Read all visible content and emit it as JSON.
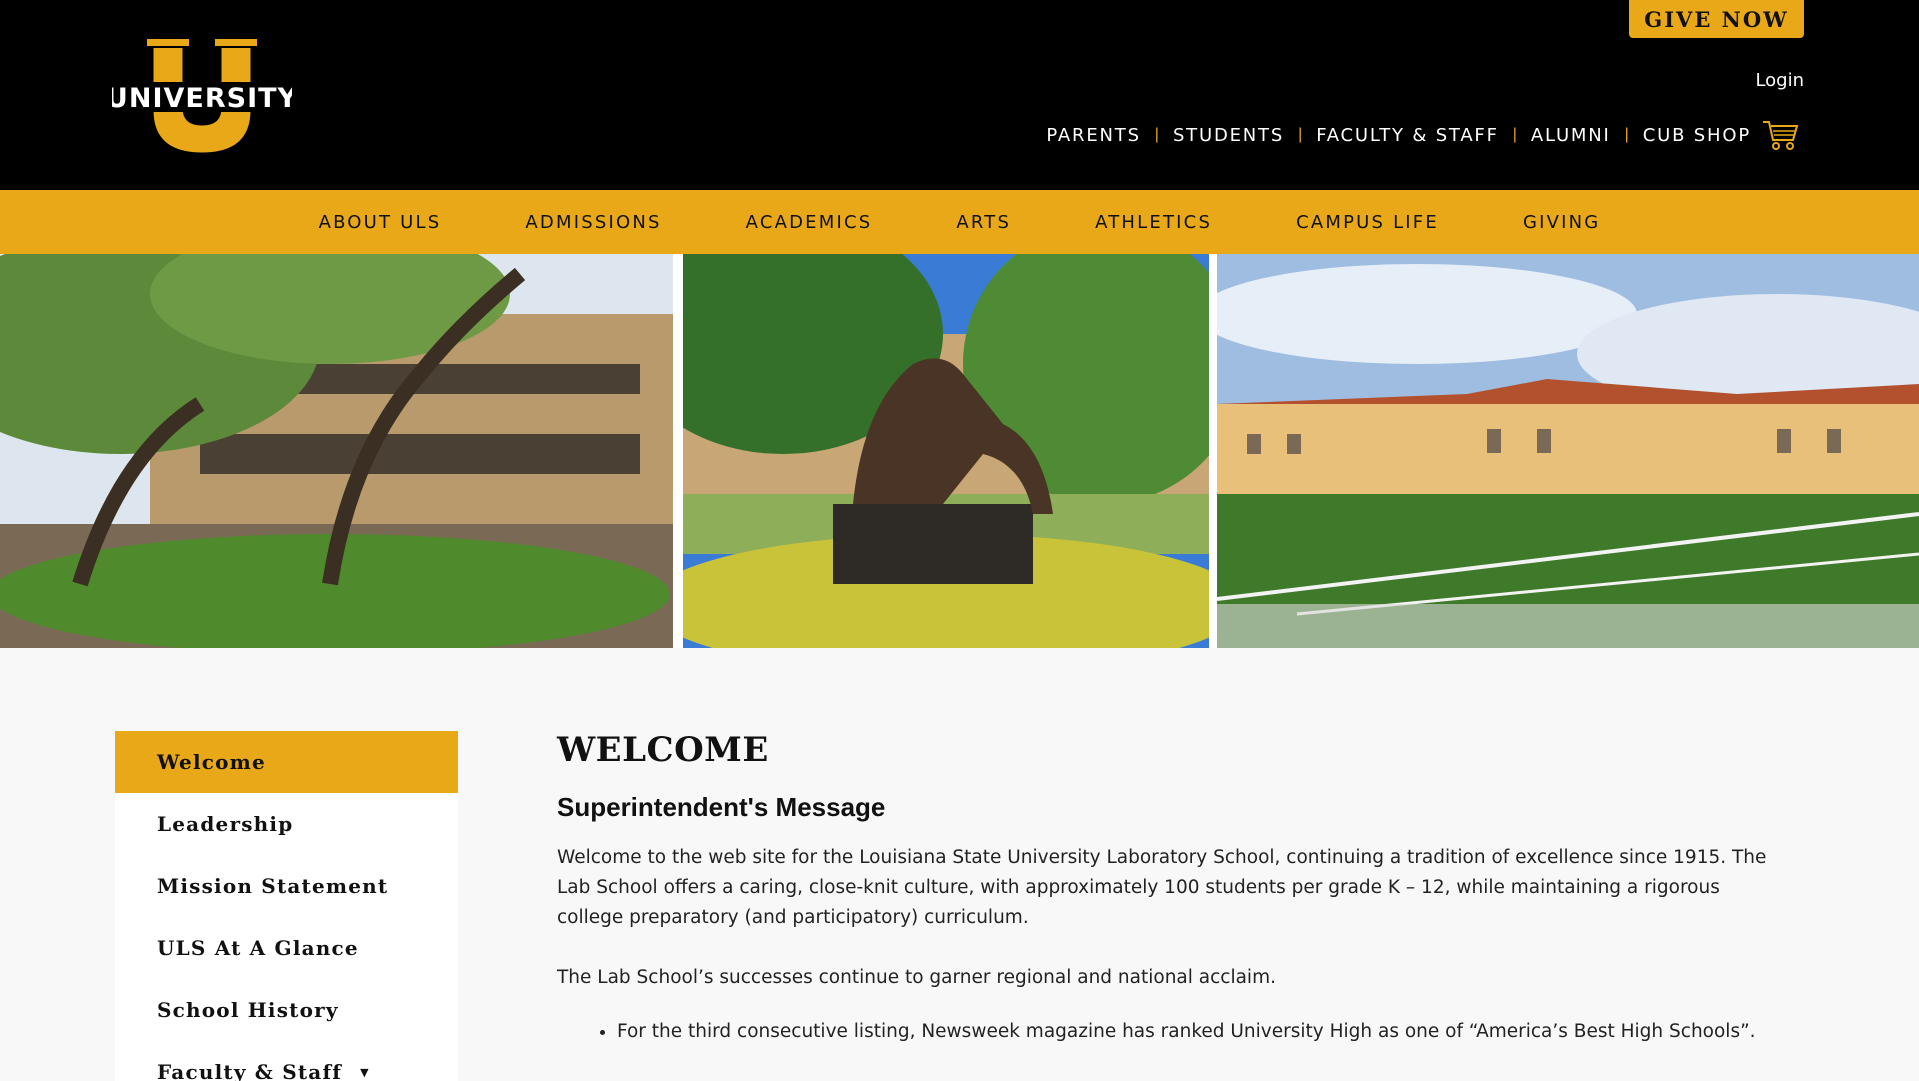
{
  "header": {
    "logo_text": "UNIVERSITY",
    "give_label": "GIVE NOW",
    "login_label": "Login",
    "top_nav": [
      "PARENTS",
      "STUDENTS",
      "FACULTY & STAFF",
      "ALUMNI",
      "CUB SHOP"
    ],
    "cart_icon": "cart-icon"
  },
  "main_nav": [
    "ABOUT ULS",
    "ADMISSIONS",
    "ACADEMICS",
    "ARTS",
    "ATHLETICS",
    "CAMPUS LIFE",
    "GIVING"
  ],
  "sidebar": {
    "items": [
      {
        "label": "Welcome",
        "active": true
      },
      {
        "label": "Leadership"
      },
      {
        "label": "Mission Statement"
      },
      {
        "label": "ULS At A Glance"
      },
      {
        "label": "School History"
      },
      {
        "label": "Faculty & Staff",
        "has_submenu": true
      }
    ]
  },
  "content": {
    "title": "WELCOME",
    "subtitle": "Superintendent's Message",
    "paragraph1": "Welcome to the web site for the Louisiana State University Laboratory School, continuing a tradition of excellence since 1915. The Lab School offers a caring, close-knit culture, with approximately 100 students per grade K – 12, while maintaining a rigorous college preparatory (and participatory) curriculum.",
    "paragraph2": "The Lab School’s successes continue to garner regional and national acclaim.",
    "bullets": [
      "For the third consecutive listing, Newsweek magazine has ranked University High as one of “America’s Best High Schools”."
    ]
  },
  "colors": {
    "brand_gold": "#e8a817",
    "header_bg": "#000000",
    "page_bg": "#f8f8f8"
  }
}
